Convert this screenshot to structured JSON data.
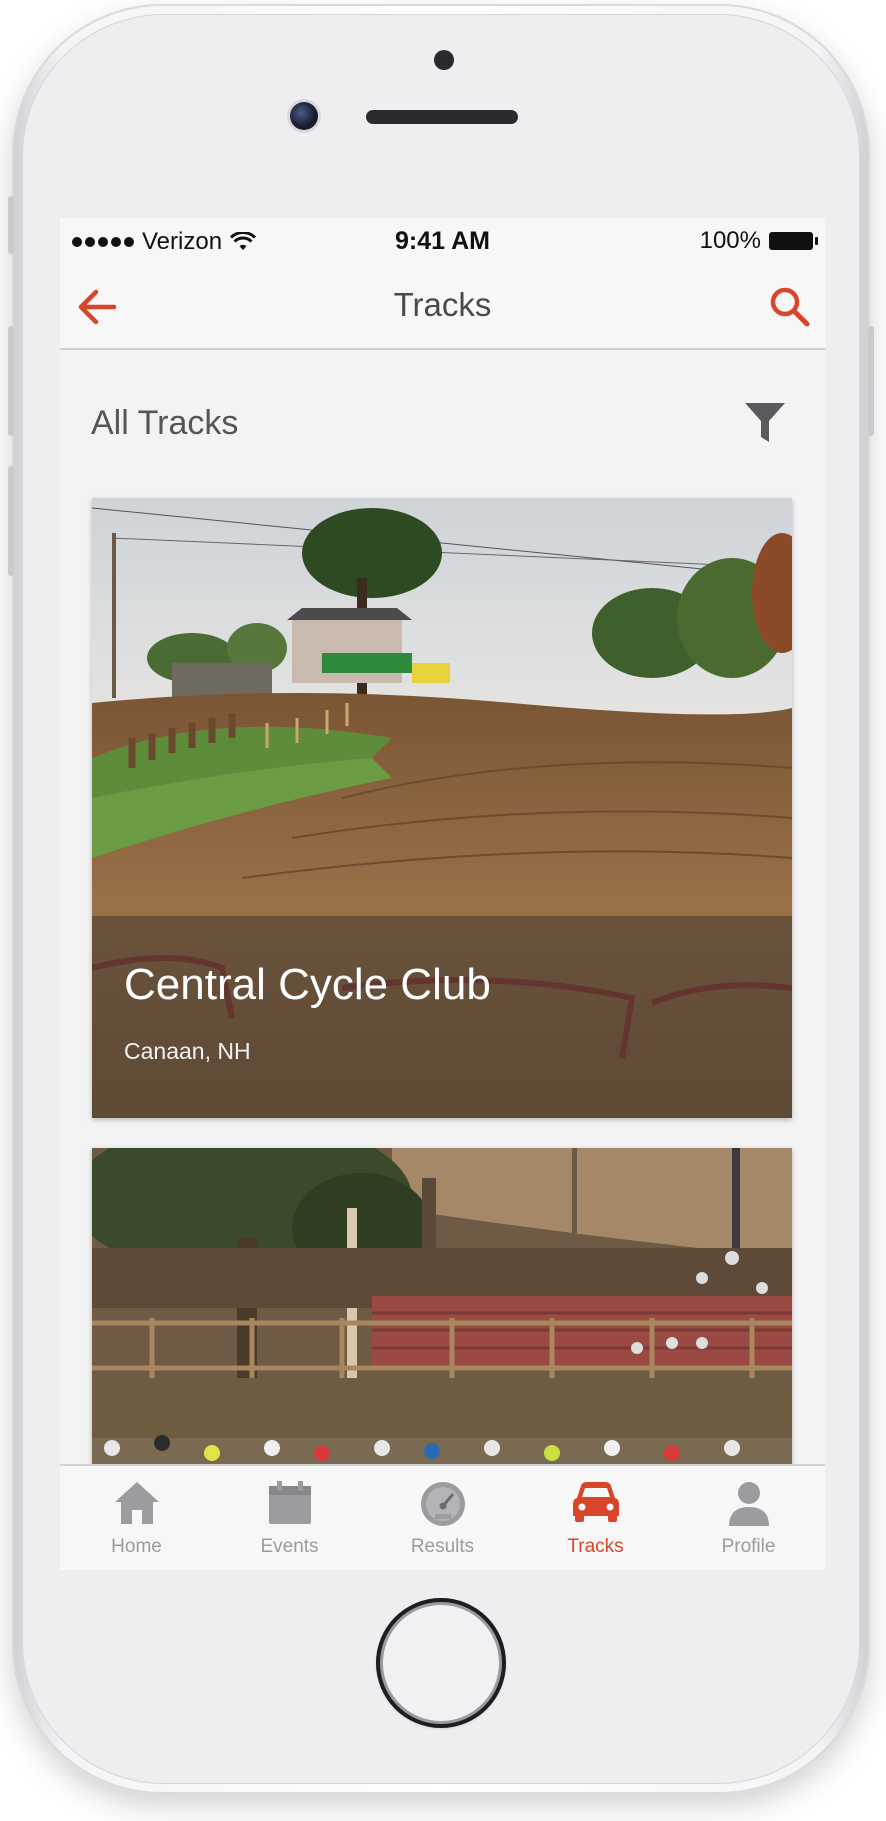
{
  "status_bar": {
    "carrier": "Verizon",
    "time": "9:41 AM",
    "battery": "100%"
  },
  "nav": {
    "title": "Tracks",
    "back_icon": "arrow-left-icon",
    "search_icon": "search-icon"
  },
  "section": {
    "title": "All Tracks",
    "filter_icon": "filter-icon"
  },
  "tracks": [
    {
      "name": "Central Cycle Club",
      "location": "Canaan, NH"
    },
    {
      "name": "",
      "location": ""
    }
  ],
  "tabs": [
    {
      "label": "Home",
      "icon": "home-icon",
      "active": false
    },
    {
      "label": "Events",
      "icon": "calendar-icon",
      "active": false
    },
    {
      "label": "Results",
      "icon": "speedometer-icon",
      "active": false
    },
    {
      "label": "Tracks",
      "icon": "car-icon",
      "active": true
    },
    {
      "label": "Profile",
      "icon": "person-icon",
      "active": false
    }
  ],
  "colors": {
    "accent": "#d9452b",
    "inactive": "#9b9ba0",
    "background": "#f3f3f4"
  }
}
